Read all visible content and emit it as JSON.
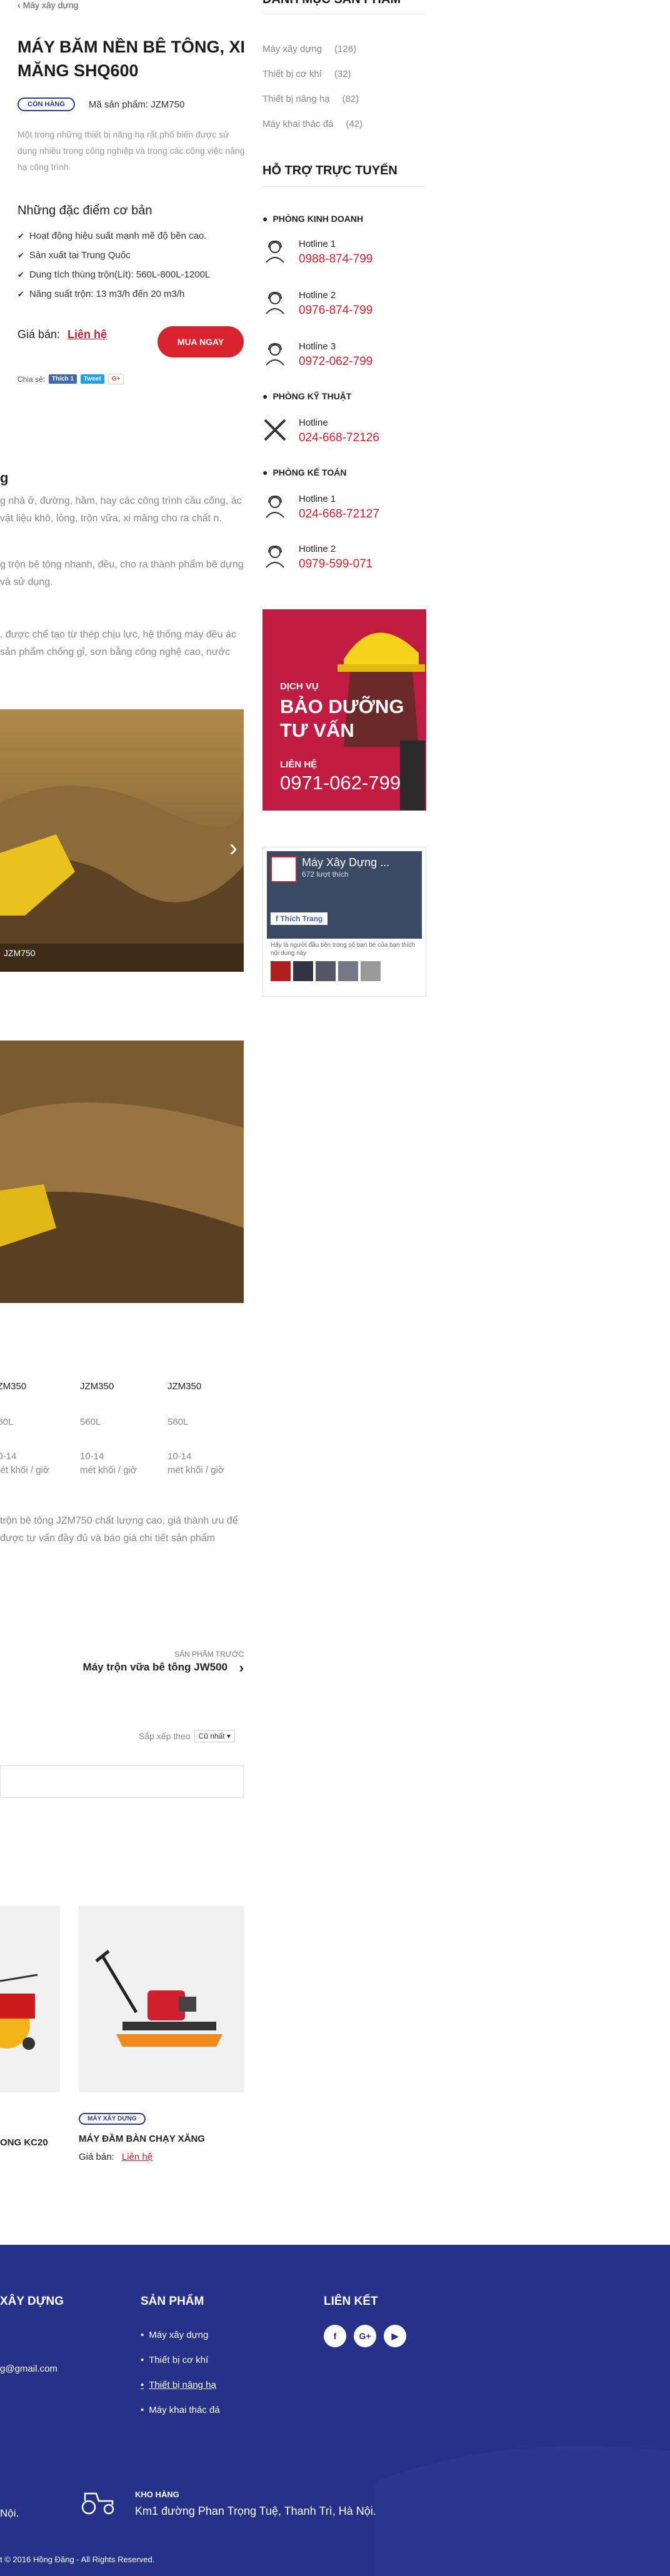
{
  "breadcrumb": {
    "back_arrow": "‹",
    "label": "Máy xây dựng"
  },
  "product": {
    "title": "MÁY BĂM NỀN BÊ TÔNG, XI MĂNG SHQ600",
    "stock_badge": "CÒN HÀNG",
    "code_label": "Mã sản phẩm:",
    "code": "JZM750",
    "description": "Một trong những thiết bị nâng hạ rất phổ biến được sử dụng nhiều trong công nghiệp và trong các công việc nâng hạ công trình",
    "features_title": "Những đặc điểm cơ bản",
    "features": [
      "Hoạt động hiệu suất mạnh mẽ độ bền cao.",
      "Sản xuất tại Trung Quốc",
      "Dung tích thùng trộn(Lít): 560L-800L-1200L",
      "Năng suất trộn: 13 m3/h đến 20 m3/h"
    ],
    "price_label": "Giá bán:",
    "price_value": "Liên hệ",
    "buy_button": "MUA NGAY",
    "share_label": "Chia sẻ:",
    "share_buttons": [
      "Thích 1",
      "Tweet",
      "G+"
    ]
  },
  "content": {
    "heading_partial": "g",
    "para1": "g nhà ở, đường, hầm, hay các công trình cầu cống, ác vật liệu khô, lỏng, trộn vữa, xi măng cho ra chất n.",
    "para2": "g trộn bê tông nhanh, đều, cho ra thành phẩm bê dựng và sử dụng.",
    "para3": ", được chế tạo từ thép chịu lực, hệ thống máy đều ác sản phẩm chống gỉ, sơn bằng công nghệ cao, nước",
    "photo_caption": "JZM750",
    "table": {
      "columns": [
        {
          "head": "JZM350",
          "vals": [
            "560L",
            "10-14",
            "mét khối / giờ"
          ]
        },
        {
          "head": "JZM350",
          "vals": [
            "560L",
            "10-14",
            "mét khối / giờ"
          ]
        },
        {
          "head": "JZM350",
          "vals": [
            "560L",
            "10-14",
            "mét khối / giờ"
          ]
        }
      ]
    },
    "para4": "trộn bê tông JZM750 chất lượng cao, giá thành ưu để được tư vấn đầy đủ và báo giá chi tiết sản phẩm"
  },
  "pagination": {
    "prev_label": "SẢN PHẨM TRƯỚC",
    "prev_title": "Máy trộn vữa bê tông JW500"
  },
  "sort": {
    "label": "Sắp xếp theo",
    "value": "Cũ nhất"
  },
  "related": [
    {
      "title": "ONG KC20"
    },
    {
      "badge": "MÁY XÂY DỰNG",
      "title": "MÁY ĐẦM BÀN CHẠY XĂNG",
      "price_label": "Giá bán:",
      "price_value": "Liên hệ"
    }
  ],
  "sidebar": {
    "categories_title": "DANH MỤC SẢN PHẨM",
    "categories": [
      {
        "name": "Máy xây dựng",
        "count": "(126)",
        "active": false
      },
      {
        "name": "Thiết bị cơ khí",
        "count": "(32)",
        "active": true
      },
      {
        "name": "Thiết bị nâng hạ",
        "count": "(82)",
        "active": false
      },
      {
        "name": "Máy khai thác đá",
        "count": "(42)",
        "active": false
      }
    ],
    "support_title": "HỖ TRỢ TRỰC TUYẾN",
    "departments": [
      {
        "name": "PHÒNG KINH DOANH",
        "lines": [
          {
            "label": "Hotline 1",
            "number": "0988-874-799"
          },
          {
            "label": "Hotline 2",
            "number": "0976-874-799"
          },
          {
            "label": "Hotline 3",
            "number": "0972-062-799"
          }
        ]
      },
      {
        "name": "PHÒNG KỸ THUẬT",
        "lines": [
          {
            "label": "Hotline",
            "number": "024-668-72126"
          }
        ]
      },
      {
        "name": "PHÒNG KẾ TOÁN",
        "lines": [
          {
            "label": "Hotline 1",
            "number": "024-668-72127"
          },
          {
            "label": "Hotline 2",
            "number": "0979-599-071"
          }
        ]
      }
    ],
    "banner": {
      "line1": "DỊCH VỤ",
      "line2": "BẢO DƯỠNG",
      "line3": "TƯ VẤN",
      "contact": "LIÊN HỆ",
      "phone": "0971-062-799"
    },
    "facebook": {
      "page_name": "Máy Xây Dựng ...",
      "likes": "672 lượt thích",
      "like_button": "Thích Trang",
      "note": "Hãy là người đầu tiên trong số bạn bè của bạn thích nội dung này"
    }
  },
  "footer": {
    "col1_title": "XÂY DỰNG",
    "email_partial": "g@gmail.com",
    "col2_title": "SẢN PHẨM",
    "links": [
      "Máy xây dựng",
      "Thiết bị cơ khí",
      "Thiết bị nâng hạ",
      "Máy khai thác đá"
    ],
    "col3_title": "LIÊN KẾT",
    "social": [
      "f",
      "G+",
      "▶"
    ],
    "address_partial": "Nội.",
    "warehouse_title": "KHO HÀNG",
    "warehouse_address": "Km1 đường Phan Trọng Tuệ, Thanh Trì, Hà Nội.",
    "copyright": "t © 2016 Hồng Đăng - All Rights Reserved."
  },
  "colors": {
    "accent_red": "#d0202e",
    "brand_blue": "#26318a",
    "banner_red": "#c21b42"
  }
}
